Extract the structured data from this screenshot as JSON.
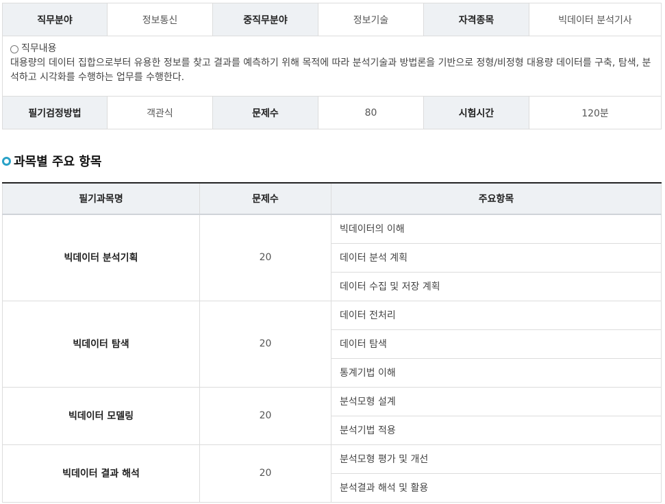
{
  "info": {
    "row1": [
      {
        "label": "직무분야",
        "value": "정보통신"
      },
      {
        "label": "중직무분야",
        "value": "정보기술"
      },
      {
        "label": "자격종목",
        "value": "빅데이터 분석기사"
      }
    ],
    "desc_title": "직무내용",
    "desc_text": "대용량의 데이터 집합으로부터 유용한 정보를 찾고 결과를 예측하기 위해 목적에 따라 분석기술과 방법론을 기반으로 정형/비정형 대용량 데이터를 구축, 탐색, 분석하고 시각화를 수행하는 업무를 수행한다.",
    "row3": [
      {
        "label": "필기검정방법",
        "value": "객관식"
      },
      {
        "label": "문제수",
        "value": "80"
      },
      {
        "label": "시험시간",
        "value": "120분"
      }
    ]
  },
  "section_title": "과목별 주요 항목",
  "subjects_table": {
    "headers": [
      "필기과목명",
      "문제수",
      "주요항목"
    ],
    "subjects": [
      {
        "name": "빅데이터 분석기획",
        "count": "20",
        "items": [
          "빅데이터의 이해",
          "데이터 분석 계획",
          "데이터 수집 및 저장 계획"
        ]
      },
      {
        "name": "빅데이터 탐색",
        "count": "20",
        "items": [
          "데이터 전처리",
          "데이터 탐색",
          "통계기법 이해"
        ]
      },
      {
        "name": "빅데이터 모델링",
        "count": "20",
        "items": [
          "분석모형 설계",
          "분석기법 적용"
        ]
      },
      {
        "name": "빅데이터 결과 해석",
        "count": "20",
        "items": [
          "분석모형 평가 및 개선",
          "분석결과 해석 및 활용"
        ]
      }
    ]
  }
}
